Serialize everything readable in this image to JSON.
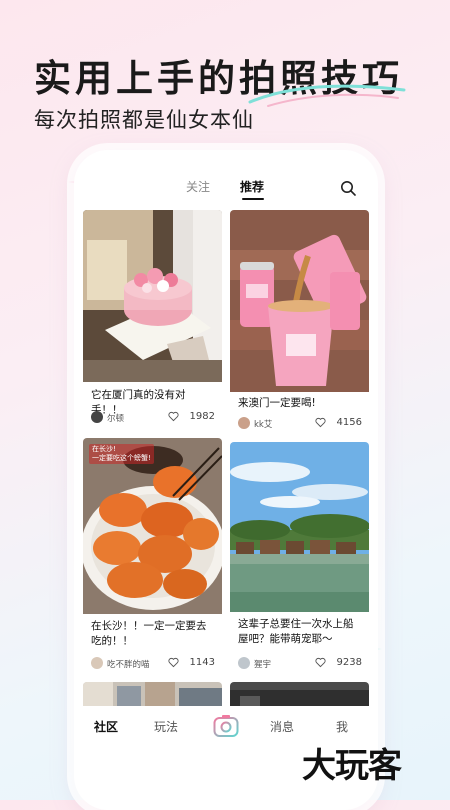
{
  "promo": {
    "headline": "实用上手的拍照技巧",
    "subheadline": "每次拍照都是仙女本仙",
    "brand_logo": "大玩客"
  },
  "topbar": {
    "tabs": [
      {
        "label": "关注",
        "active": false
      },
      {
        "label": "推荐",
        "active": true
      }
    ],
    "search_icon": "search-icon"
  },
  "feed": {
    "posts": [
      {
        "title": "它在厦门真的没有对手！！",
        "author": "尔顿",
        "likes": "1982",
        "image": "cake-photo"
      },
      {
        "title": "来澳门一定要喝!",
        "author": "kk艾",
        "likes": "4156",
        "image": "drink-photo"
      },
      {
        "title": "在长沙！！一定一定要去吃的！！",
        "author": "吃不胖的喵",
        "likes": "1143",
        "image": "crab-photo",
        "image_overlay_text": "在长沙!\n一定要吃这个螃蟹!"
      },
      {
        "title": "这辈子总要住一次水上船屋吧？能带萌宠耶～",
        "author": "猩宇",
        "likes": "9238",
        "image": "lake-house-photo"
      }
    ]
  },
  "bottom_nav": {
    "items": [
      {
        "label": "社区",
        "active": true
      },
      {
        "label": "玩法",
        "active": false
      },
      {
        "label": "",
        "icon": "camera-icon"
      },
      {
        "label": "消息",
        "active": false
      },
      {
        "label": "我",
        "active": false
      }
    ]
  },
  "colors": {
    "accent_pink": "#f07aa0",
    "accent_teal": "#5fd6d0",
    "background_pink": "#fde7ee",
    "background_blue": "#e7f4fb"
  }
}
